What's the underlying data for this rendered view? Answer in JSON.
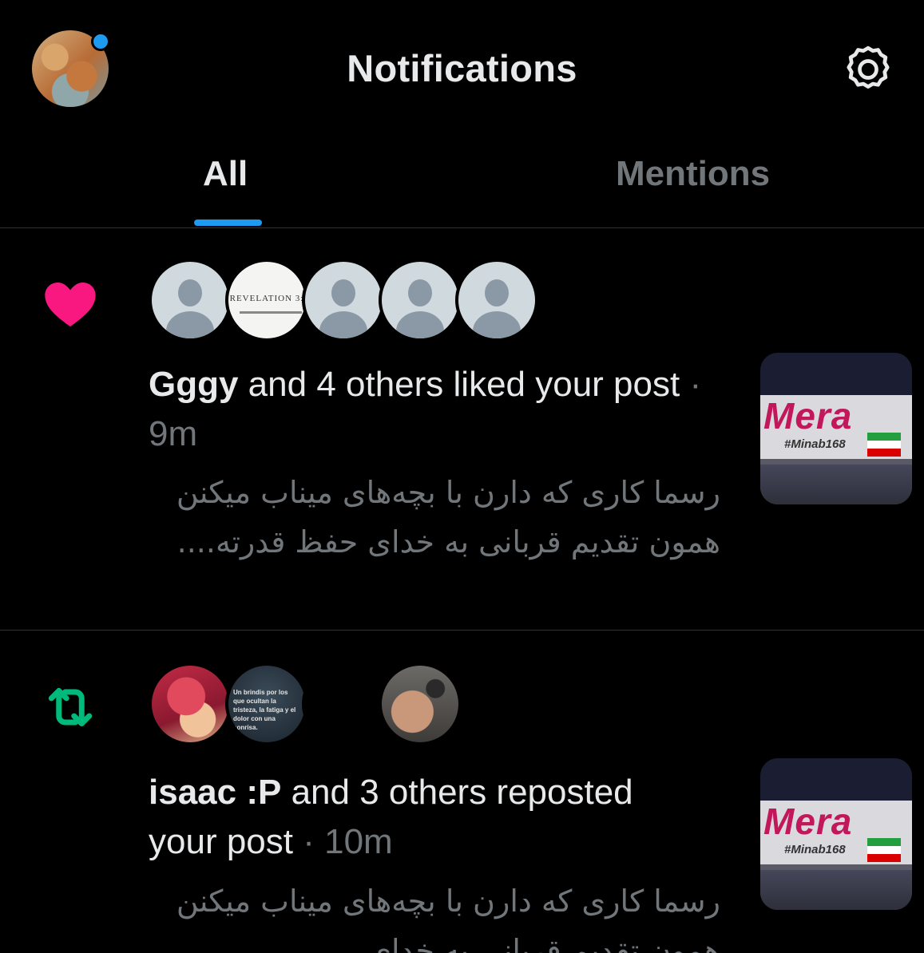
{
  "header": {
    "title": "Notifications",
    "avatar_icon": "profile-avatar",
    "settings_icon": "gear-icon"
  },
  "tabs": [
    {
      "label": "All",
      "active": true
    },
    {
      "label": "Mentions",
      "active": false
    }
  ],
  "colors": {
    "accent": "#1d9bf0",
    "like": "#f91880",
    "repost": "#00ba7c",
    "background": "#000000",
    "secondary_text": "#71767b"
  },
  "notifications": [
    {
      "type": "like",
      "icon": "heart-icon",
      "avatar_revelation_text": "REVELATION 3:",
      "actor": "Gggy",
      "action": " and 4 others liked your post",
      "separator": " · ",
      "time": "9m",
      "snippet": "رسما کاری که دارن با بچه‌های میناب میکنن همون تقدیم قربانی به خدای حفظ قدرته....",
      "thumbnail": {
        "brand": "Mera",
        "tag": "#Minab168"
      }
    },
    {
      "type": "repost",
      "icon": "repost-icon",
      "avatar_quote_text": "Un brindis por los que ocultan la tristeza, la fatiga y el dolor con una sonrisa.",
      "actor": "isaac :P",
      "action": " and 3 others reposted your post",
      "separator": " · ",
      "time": "10m",
      "snippet": "رسما کاری که دارن با بچه‌های میناب میکنن همون تقدیم قربانی به خدای",
      "thumbnail": {
        "brand": "Mera",
        "tag": "#Minab168"
      }
    }
  ]
}
